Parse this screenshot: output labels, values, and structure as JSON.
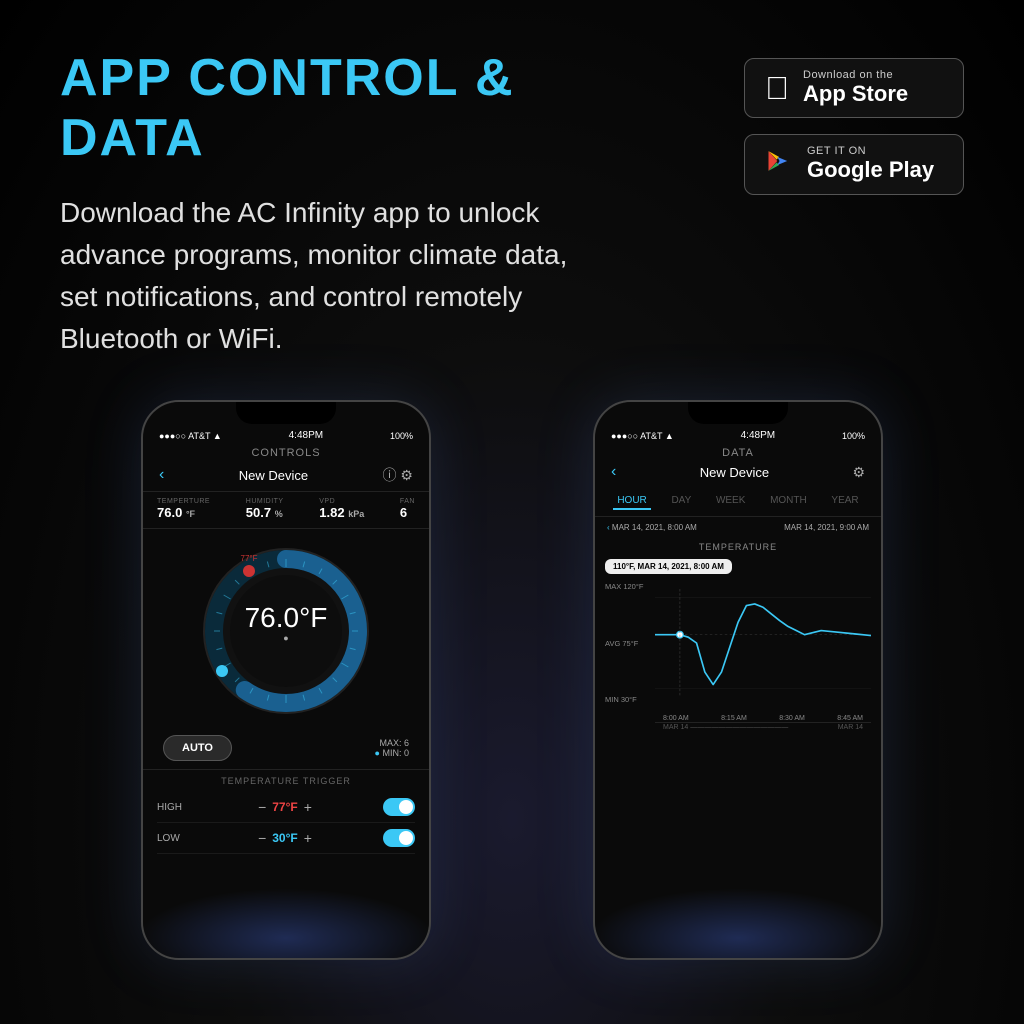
{
  "page": {
    "title": "APP CONTROL & DATA",
    "description": "Download the AC Infinity app to unlock advance programs, monitor climate data, set notifications, and control remotely Bluetooth or WiFi.",
    "background": "#000000",
    "accent_color": "#3bc8f5"
  },
  "app_store": {
    "subtitle": "Download on the",
    "name": "App Store"
  },
  "google_play": {
    "subtitle": "GET IT ON",
    "name": "Google Play"
  },
  "phone_left": {
    "status": {
      "carrier": "●●●○○ AT&T ▲",
      "time": "4:48PM",
      "battery": "100%"
    },
    "screen_title": "CONTROLS",
    "device_name": "New Device",
    "sensors": {
      "temperature": {
        "label": "TEMPERTURE",
        "value": "76.0",
        "unit": "°F"
      },
      "humidity": {
        "label": "HUMIDITY",
        "value": "50.7",
        "unit": "%"
      },
      "vpd": {
        "label": "VPD",
        "value": "1.82",
        "unit": "kPa"
      },
      "fan": {
        "label": "FAN",
        "value": "6"
      }
    },
    "dial_value": "76.0°F",
    "auto_label": "AUTO",
    "max_label": "MAX: 6",
    "min_label": "MIN: 0",
    "trigger_section_title": "TEMPERATURE TRIGGER",
    "triggers": [
      {
        "label": "HIGH",
        "value": "77°F",
        "color": "#ee4444",
        "enabled": true
      },
      {
        "label": "LOW",
        "value": "30°F",
        "color": "#3bc8f5",
        "enabled": true
      }
    ]
  },
  "phone_right": {
    "status": {
      "carrier": "●●●○○ AT&T ▲",
      "time": "4:48PM",
      "battery": "100%"
    },
    "screen_title": "DATA",
    "device_name": "New Device",
    "time_tabs": [
      "HOUR",
      "DAY",
      "WEEK",
      "MONTH",
      "YEAR"
    ],
    "active_tab": "HOUR",
    "date_range_start": "MAR 14, 2021, 8:00 AM",
    "date_range_end": "MAR 14, 2021, 9:00 AM",
    "chart_title": "TEMPERATURE",
    "tooltip": "110°F, MAR 14, 2021, 8:00 AM",
    "chart_labels": {
      "max": "MAX 120°F",
      "avg": "AVG 75°F",
      "min": "MIN 30°F"
    },
    "x_axis": [
      "8:00 AM",
      "8:15 AM",
      "8:30 AM",
      "8:45 AM"
    ],
    "date_axis": [
      "MAR 14",
      "MAR 14"
    ]
  }
}
